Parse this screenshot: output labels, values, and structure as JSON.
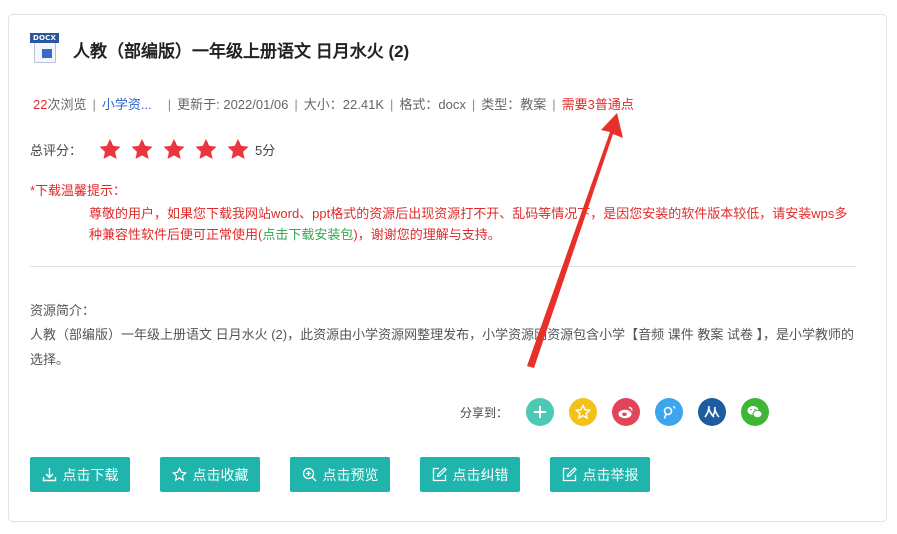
{
  "file": {
    "type_tag": "DOCX"
  },
  "title": "人教（部编版）一年级上册语文 日月水火 (2)",
  "meta": {
    "views_count": "22",
    "views_suffix": "次浏览",
    "category": "小学资...",
    "updated": "更新于: 2022/01/06",
    "size": "大小：22.41K",
    "format": "格式：docx",
    "type": "类型：教案",
    "requirement": "需要3普通点",
    "separator": "|"
  },
  "rating": {
    "label": "总评分：",
    "stars": 5,
    "score_text": "5分",
    "star_color": "#e8383d"
  },
  "tips": {
    "title": "*下载温馨提示：",
    "body_before": "尊敬的用户，如果您下载我网站word、ppt格式的资源后出现资源打不开、乱码等情况下，是因您安装的软件版本较低，请安装wps多种兼容性软件后便可正常使用(",
    "link": "点击下载安装包",
    "body_after": ")，谢谢您的理解与支持。"
  },
  "intro": {
    "title": "资源简介：",
    "body": "人教（部编版）一年级上册语文 日月水火 (2)，此资源由小学资源网整理发布，小学资源网资源包含小学【音频 课件 教案 试卷 】，是小学教师的选择。"
  },
  "share": {
    "label": "分享到：",
    "icons": [
      {
        "name": "share-more-icon",
        "color": "#4cc8b4"
      },
      {
        "name": "qzone-icon",
        "color": "#f2c21b"
      },
      {
        "name": "weibo-icon",
        "color": "#e0455a"
      },
      {
        "name": "tencent-weibo-icon",
        "color": "#3da5ee"
      },
      {
        "name": "renren-icon",
        "color": "#1d5c9f"
      },
      {
        "name": "wechat-icon",
        "color": "#3fb535"
      }
    ]
  },
  "actions": {
    "download": "点击下载",
    "favorite": "点击收藏",
    "preview": "点击预览",
    "correct": "点击纠错",
    "report": "点击举报"
  },
  "colors": {
    "accent": "#1fb5ad",
    "warning": "#e02b2b",
    "annotation_arrow": "#e8302a"
  }
}
